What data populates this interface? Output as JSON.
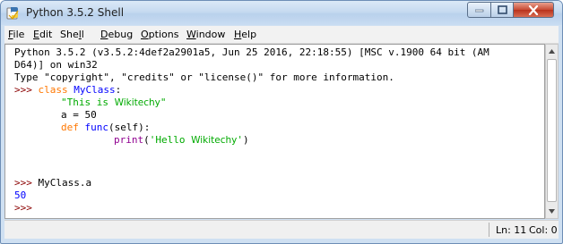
{
  "window": {
    "title": "Python 3.5.2 Shell"
  },
  "menu": {
    "file": {
      "key": "F",
      "rest": "ile"
    },
    "edit": {
      "key": "E",
      "rest": "dit"
    },
    "shell": {
      "pre": "She",
      "key": "l",
      "rest": "l"
    },
    "debug": {
      "key": "D",
      "rest": "ebug"
    },
    "options": {
      "key": "O",
      "rest": "ptions"
    },
    "window": {
      "key": "W",
      "rest": "indow"
    },
    "help": {
      "key": "H",
      "rest": "elp"
    }
  },
  "shell": {
    "banner1": "Python 3.5.2 (v3.5.2:4def2a2901a5, Jun 25 2016, 22:18:55) [MSC v.1900 64 bit (AM",
    "banner2": "D64)] on win32",
    "banner3": "Type \"copyright\", \"credits\" or \"license()\" for more information.",
    "prompt": ">>>",
    "kw_class": "class",
    "class_name": "MyClass",
    "colon": ":",
    "docstring_q1": "\"This is ",
    "docstring_word": "Wikitechy",
    "docstring_q2": "\"",
    "assign": "a = 50",
    "kw_def": "def",
    "func_name": "func",
    "func_args": "(self):",
    "print_kw": "print",
    "print_open": "(",
    "print_str1": "'Hello ",
    "print_word": "Wikitechy",
    "print_str2": "'",
    "print_close": ")",
    "cmd": "MyClass.a",
    "output": "50"
  },
  "status": {
    "line": "Ln: 11",
    "col": "Col: 0"
  }
}
